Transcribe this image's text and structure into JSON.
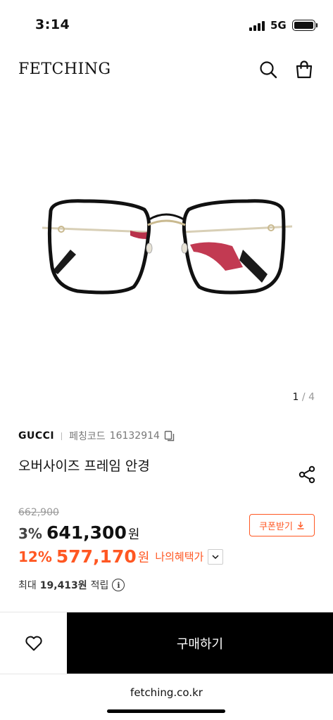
{
  "status_bar": {
    "time": "3:14",
    "network": "5G"
  },
  "header": {
    "logo": "FETCHING",
    "search_icon": "search-icon",
    "bag_icon": "shopping-bag-icon"
  },
  "gallery": {
    "current": "1",
    "separator": "/",
    "total": "4"
  },
  "product": {
    "brand": "GUCCI",
    "code_label": "페칭코드",
    "code": "16132914",
    "title": "오버사이즈 프레임 안경"
  },
  "pricing": {
    "original_price": "662,900",
    "discount_rate": "3%",
    "sale_price": "641,300",
    "currency": "원",
    "coupon_label": "쿠폰받기",
    "benefit_rate": "12%",
    "benefit_price": "577,170",
    "benefit_label": "나의혜택가",
    "points_prefix": "최대",
    "points_value": "19,413원",
    "points_suffix": "적립",
    "info_glyph": "i"
  },
  "actions": {
    "buy_label": "구매하기",
    "wish_icon": "heart-icon"
  },
  "browser": {
    "url": "fetching.co.kr"
  },
  "colors": {
    "accent": "#ff5722",
    "buy_button": "#000000"
  }
}
